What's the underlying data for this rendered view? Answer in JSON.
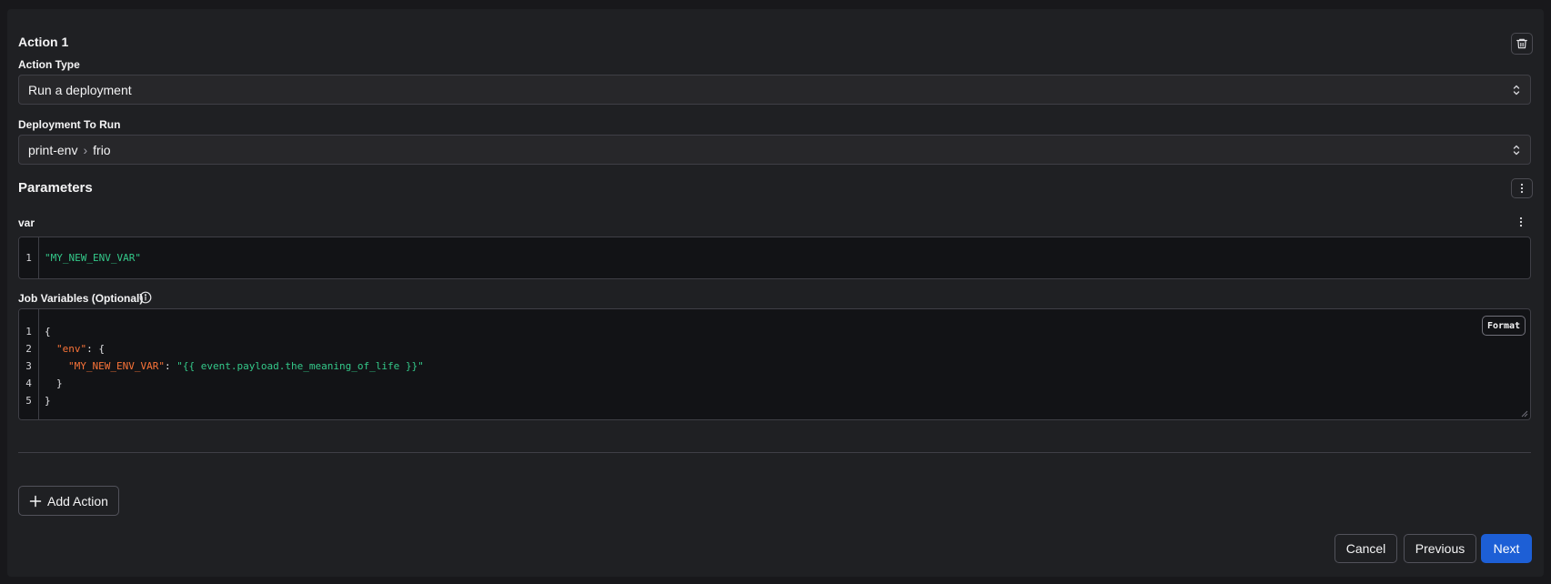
{
  "action": {
    "title": "Action 1",
    "type_label": "Action Type",
    "type_value": "Run a deployment",
    "deployment_label": "Deployment To Run",
    "deployment_flow": "print-env",
    "deployment_separator": "›",
    "deployment_name": "frio"
  },
  "parameters": {
    "title": "Parameters",
    "param_name": "var",
    "param_value": "\"MY_NEW_ENV_VAR\"",
    "line_numbers": [
      "1"
    ]
  },
  "job_variables": {
    "label": "Job Variables (Optional)",
    "format_label": "Format",
    "line_numbers": [
      "1",
      "2",
      "3",
      "4",
      "5"
    ],
    "lines": {
      "l1": "{",
      "l2_key": "\"env\"",
      "l2_rest": ": {",
      "l3_key": "\"MY_NEW_ENV_VAR\"",
      "l3_colon": ": ",
      "l3_value": "\"{{ event.payload.the_meaning_of_life }}\"",
      "l4": "}",
      "l5": "}"
    }
  },
  "footer": {
    "add_action_label": "Add Action",
    "cancel_label": "Cancel",
    "previous_label": "Previous",
    "next_label": "Next"
  },
  "colors": {
    "primary": "#1d5fd6",
    "string": "#34c98a",
    "key": "#f97338",
    "background": "#1f2023"
  }
}
